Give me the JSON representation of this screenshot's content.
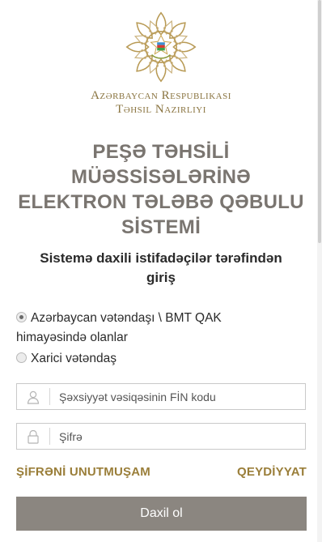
{
  "ministry": {
    "line1": "Azərbaycan Respublikası",
    "line2": "Təhsil Nazirliyi"
  },
  "title": {
    "line1": "PEŞƏ TƏHSİLİ",
    "line2": "MÜƏSSİSƏLƏRİNƏ",
    "line3": "ELEKTRON TƏLƏBƏ QƏBULU",
    "line4": "SİSTEMİ"
  },
  "subtitle": {
    "line1": "Sistemə daxili istifadəçilər tərəfindən",
    "line2": "giriş"
  },
  "citizenship": {
    "option1": {
      "line1": "Azərbaycan vətəndaşı \\ BMT QAK",
      "line2": "himayəsində olanlar",
      "checked": true
    },
    "option2": {
      "label": "Xarici vətəndaş",
      "checked": false
    }
  },
  "login": {
    "fin_placeholder": "Şəxsiyyət vəsiqəsinin FİN kodu",
    "password_placeholder": "Şifrə"
  },
  "links": {
    "forgot": "ŞİFRƏNİ UNUTMUŞAM",
    "register": "QEYDİYYAT"
  },
  "submit_label": "Daxil ol",
  "colors": {
    "gold": "#9a7e39",
    "title_gray": "#7a7570",
    "button": "#8b8680"
  }
}
